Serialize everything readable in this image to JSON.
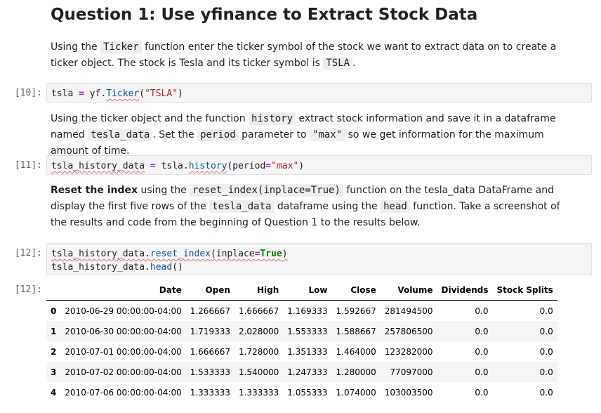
{
  "heading": "Question 1: Use yfinance to Extract Stock Data",
  "md1": {
    "a": "Using the ",
    "code1": "Ticker",
    "b": " function enter the ticker symbol of the stock we want to extract data on to create a ticker object. The stock is Tesla and its ticker symbol is ",
    "code2": "TSLA",
    "c": "."
  },
  "cell10": {
    "prompt": "[10]:",
    "t1": "tsla ",
    "op": "=",
    "t2": " yf.",
    "fn": "Ticker",
    "t3": "(",
    "str": "\"TSLA\"",
    "t4": ")"
  },
  "md2": {
    "a": "Using the ticker object and the function ",
    "code1": "history",
    "b": " extract stock information and save it in a dataframe named ",
    "code2": "tesla_data",
    "c": ". Set the ",
    "code3": "period",
    "d": " parameter to ",
    "code4": "\"max\"",
    "e": " so we get information for the maximum amount of time."
  },
  "cell11": {
    "prompt": "[11]:",
    "t1": "tsla_history_data",
    "t1b": " ",
    "op": "=",
    "t2": " tsla.",
    "fn": "history",
    "t3": "(period",
    "op2": "=",
    "str": "\"max\"",
    "t4": ")"
  },
  "md3": {
    "bold": "Reset the index",
    "a": " using the ",
    "code1": "reset_index(inplace=True)",
    "b": " function on the tesla_data DataFrame and display the first five rows of the ",
    "code2": "tesla_data",
    "c": " dataframe using the ",
    "code3": "head",
    "d": " function. Take a screenshot of the results and code from the beginning of Question 1 to the results below."
  },
  "cell12": {
    "prompt": "[12]:",
    "l1_t1": "tsla_history_data.",
    "l1_fn": "reset_index",
    "l1_t2": "(inplace",
    "l1_op": "=",
    "l1_kw": "True",
    "l1_t3": ")",
    "l2_t1": "tsla_history_data.",
    "l2_fn": "head",
    "l2_t2": "()"
  },
  "output12": {
    "prompt": "[12]:",
    "columns": [
      "Date",
      "Open",
      "High",
      "Low",
      "Close",
      "Volume",
      "Dividends",
      "Stock Splits"
    ],
    "rows": [
      {
        "index": "0",
        "cells": [
          "2010-06-29 00:00:00-04:00",
          "1.266667",
          "1.666667",
          "1.169333",
          "1.592667",
          "281494500",
          "0.0",
          "0.0"
        ]
      },
      {
        "index": "1",
        "cells": [
          "2010-06-30 00:00:00-04:00",
          "1.719333",
          "2.028000",
          "1.553333",
          "1.588667",
          "257806500",
          "0.0",
          "0.0"
        ]
      },
      {
        "index": "2",
        "cells": [
          "2010-07-01 00:00:00-04:00",
          "1.666667",
          "1.728000",
          "1.351333",
          "1.464000",
          "123282000",
          "0.0",
          "0.0"
        ]
      },
      {
        "index": "3",
        "cells": [
          "2010-07-02 00:00:00-04:00",
          "1.533333",
          "1.540000",
          "1.247333",
          "1.280000",
          "77097000",
          "0.0",
          "0.0"
        ]
      },
      {
        "index": "4",
        "cells": [
          "2010-07-06 00:00:00-04:00",
          "1.333333",
          "1.333333",
          "1.055333",
          "1.074000",
          "103003500",
          "0.0",
          "0.0"
        ]
      }
    ]
  }
}
